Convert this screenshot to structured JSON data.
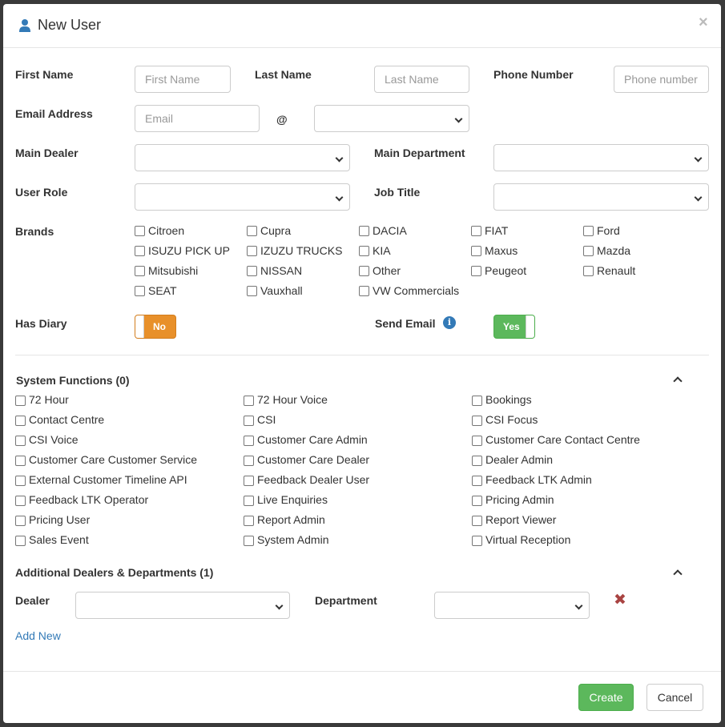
{
  "modal": {
    "title": "New User",
    "close_glyph": "×",
    "icons": {
      "title": "user-icon",
      "close": "close-icon"
    }
  },
  "form": {
    "first_name_label": "First Name",
    "first_name_placeholder": "First Name",
    "last_name_label": "Last Name",
    "last_name_placeholder": "Last Name",
    "phone_label": "Phone Number",
    "phone_placeholder": "Phone number",
    "email_label": "Email Address",
    "email_placeholder": "Email",
    "at_sign": "@",
    "main_dealer_label": "Main Dealer",
    "main_department_label": "Main Department",
    "user_role_label": "User Role",
    "job_title_label": "Job Title",
    "brands_label": "Brands",
    "has_diary_label": "Has Diary",
    "has_diary_value": "No",
    "send_email_label": "Send Email",
    "send_email_value": "Yes",
    "info_glyph": "i"
  },
  "brands": [
    "Citroen",
    "Cupra",
    "DACIA",
    "FIAT",
    "Ford",
    "ISUZU PICK UP",
    "IZUZU TRUCKS",
    "KIA",
    "Maxus",
    "Mazda",
    "Mitsubishi",
    "NISSAN",
    "Other",
    "Peugeot",
    "Renault",
    "SEAT",
    "Vauxhall",
    "VW Commercials"
  ],
  "system_functions": {
    "title": "System Functions (0)",
    "items": [
      "72 Hour",
      "72 Hour Voice",
      "Bookings",
      "Contact Centre",
      "CSI",
      "CSI Focus",
      "CSI Voice",
      "Customer Care Admin",
      "Customer Care Contact Centre",
      "Customer Care Customer Service",
      "Customer Care Dealer",
      "Dealer Admin",
      "External Customer Timeline API",
      "Feedback Dealer User",
      "Feedback LTK Admin",
      "Feedback LTK Operator",
      "Live Enquiries",
      "Pricing Admin",
      "Pricing User",
      "Report Admin",
      "Report Viewer",
      "Sales Event",
      "System Admin",
      "Virtual Reception"
    ]
  },
  "additional": {
    "title": "Additional Dealers & Departments (1)",
    "dealer_label": "Dealer",
    "department_label": "Department",
    "remove_glyph": "✖",
    "add_new": "Add New"
  },
  "footer": {
    "create": "Create",
    "cancel": "Cancel"
  },
  "colors": {
    "primary_link": "#337ab7",
    "success": "#5cb85c",
    "warning": "#e8902a",
    "danger": "#a94442"
  }
}
